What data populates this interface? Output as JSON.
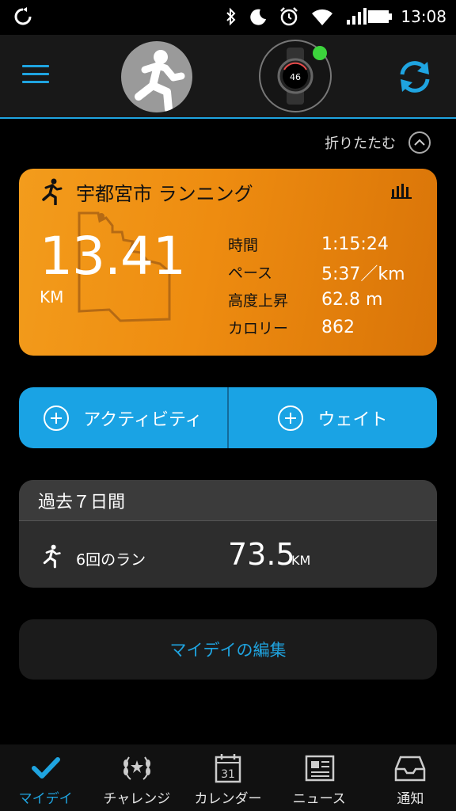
{
  "status_bar": {
    "time": "13:08",
    "icons": [
      "sync-icon",
      "bluetooth-icon",
      "moon-icon",
      "alarm-icon",
      "wifi-icon",
      "signal-icon",
      "battery-icon"
    ]
  },
  "header": {
    "menu_icon": "hamburger-icon",
    "avatar_icon": "runner-avatar-icon",
    "watch_icon": "watch-icon",
    "watch_face_value": "46",
    "watch_status_color": "#3cd43c",
    "sync_icon": "sync-icon"
  },
  "collapse": {
    "label": "折りたたむ"
  },
  "activity": {
    "title": "宇都宮市 ランニング",
    "distance": "13.41",
    "distance_unit": "KM",
    "metrics": [
      {
        "label": "時間",
        "value": "1:15:24"
      },
      {
        "label": "ペース",
        "value": "5:37／km"
      },
      {
        "label": "高度上昇",
        "value": "62.8 m"
      },
      {
        "label": "カロリー",
        "value": "862"
      }
    ],
    "colors": {
      "start": "#f39c1c",
      "end": "#d97408"
    }
  },
  "add_buttons": [
    {
      "label": "アクティビティ",
      "icon": "plus-circle-icon"
    },
    {
      "label": "ウェイト",
      "icon": "plus-circle-icon"
    }
  ],
  "weekly": {
    "header": "過去７日間",
    "runs_label": "6回のラン",
    "distance": "73.5",
    "unit": "KM"
  },
  "edit_button": {
    "label": "マイデイの編集"
  },
  "bottom_nav": [
    {
      "label": "マイデイ",
      "icon": "check-icon",
      "active": true
    },
    {
      "label": "チャレンジ",
      "icon": "laurel-icon",
      "active": false
    },
    {
      "label": "カレンダー",
      "icon": "calendar-icon",
      "calendar_day": "31",
      "active": false
    },
    {
      "label": "ニュース",
      "icon": "newspaper-icon",
      "active": false
    },
    {
      "label": "通知",
      "icon": "inbox-icon",
      "active": false
    }
  ],
  "accent_color": "#1fa4e0"
}
